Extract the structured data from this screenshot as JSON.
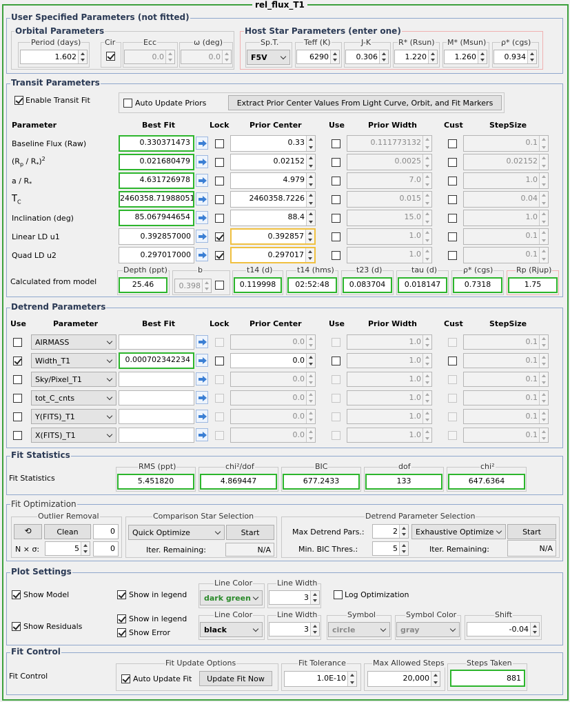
{
  "window_title": "rel_flux_T1",
  "user_params": {
    "title": "User Specified Parameters (not fitted)",
    "orbital": {
      "title": "Orbital Parameters",
      "period_label": "Period (days)",
      "period": "1.602",
      "cir_label": "Cir",
      "ecc_label": "Ecc",
      "ecc": "0.0",
      "omega_label": "ω (deg)",
      "omega": "0.0"
    },
    "host": {
      "title": "Host Star Parameters (enter one)",
      "spt_label": "Sp.T.",
      "spt": "F5V",
      "teff_label": "Teff (K)",
      "teff": "6290",
      "jk_label": "J-K",
      "jk": "0.306",
      "rstar_label": "R* (Rsun)",
      "rstar": "1.220",
      "mstar_label": "M* (Msun)",
      "mstar": "1.260",
      "rho_label": "ρ* (cgs)",
      "rho": "0.934"
    }
  },
  "transit": {
    "title": "Transit Parameters",
    "enable_label": "Enable Transit Fit",
    "auto_update_label": "Auto Update Priors",
    "extract_button": "Extract Prior Center Values From Light Curve, Orbit, and Fit Markers",
    "headers": {
      "parameter": "Parameter",
      "best_fit": "Best Fit",
      "lock": "Lock",
      "prior_center": "Prior Center",
      "use": "Use",
      "prior_width": "Prior Width",
      "cust": "Cust",
      "step": "StepSize"
    },
    "rows": [
      {
        "name": "Baseline Flux (Raw)",
        "best": "0.330371473",
        "center": "0.33",
        "width": "0.111773132",
        "step": "0.1"
      },
      {
        "name": "(Rp / R*)2",
        "best": "0.021680479",
        "center": "0.02152",
        "width": "0.0025",
        "step": "0.02152"
      },
      {
        "name": "a / R*",
        "best": "4.631726978",
        "center": "4.979",
        "width": "7.0",
        "step": "1.0"
      },
      {
        "name": "TC",
        "best": "2460358.719880510",
        "center": "2460358.7226",
        "width": "0.015",
        "step": "0.04"
      },
      {
        "name": "Inclination (deg)",
        "best": "85.067944654",
        "center": "88.4",
        "width": "15.0",
        "step": "1.0"
      },
      {
        "name": "Linear LD u1",
        "best": "0.392857000",
        "center": "0.392857",
        "width": "1.0",
        "step": "0.1"
      },
      {
        "name": "Quad LD u2",
        "best": "0.297017000",
        "center": "0.297017",
        "width": "1.0",
        "step": "0.1"
      }
    ],
    "calc_label": "Calculated from model",
    "calc": [
      {
        "label": "Depth (ppt)",
        "value": "25.46"
      },
      {
        "label": "b",
        "value": "0.398"
      },
      {
        "label": "t14 (d)",
        "value": "0.119998"
      },
      {
        "label": "t14 (hms)",
        "value": "02:52:48"
      },
      {
        "label": "t23 (d)",
        "value": "0.083704"
      },
      {
        "label": "tau (d)",
        "value": "0.018147"
      },
      {
        "label": "ρ* (cgs)",
        "value": "0.7318"
      },
      {
        "label": "Rp (Rjup)",
        "value": "1.75"
      }
    ]
  },
  "detrend": {
    "title": "Detrend Parameters",
    "headers": {
      "use": "Use",
      "parameter": "Parameter",
      "best_fit": "Best Fit",
      "lock": "Lock",
      "prior_center": "Prior Center",
      "use2": "Use",
      "prior_width": "Prior Width",
      "cust": "Cust",
      "step": "StepSize"
    },
    "rows": [
      {
        "name": "AIRMASS",
        "best": "",
        "center": "0.0",
        "width": "1.0",
        "step": "0.1"
      },
      {
        "name": "Width_T1",
        "best": "0.000702342234",
        "center": "0.0",
        "width": "1.0",
        "step": "0.1"
      },
      {
        "name": "Sky/Pixel_T1",
        "best": "",
        "center": "0.0",
        "width": "1.0",
        "step": "0.1"
      },
      {
        "name": "tot_C_cnts",
        "best": "",
        "center": "0.0",
        "width": "1.0",
        "step": "0.1"
      },
      {
        "name": "Y(FITS)_T1",
        "best": "",
        "center": "0.0",
        "width": "1.0",
        "step": "0.1"
      },
      {
        "name": "X(FITS)_T1",
        "best": "",
        "center": "0.0",
        "width": "1.0",
        "step": "0.1"
      }
    ]
  },
  "fit_stats": {
    "title": "Fit Statistics",
    "label": "Fit Statistics",
    "items": [
      {
        "label": "RMS (ppt)",
        "value": "5.451820"
      },
      {
        "label": "chi²/dof",
        "value": "4.869447"
      },
      {
        "label": "BIC",
        "value": "677.2433"
      },
      {
        "label": "dof",
        "value": "133"
      },
      {
        "label": "chi²",
        "value": "647.6364"
      }
    ]
  },
  "fit_opt": {
    "title": "Fit Optimization",
    "outlier": {
      "title": "Outlier Removal",
      "clean": "Clean",
      "count1": "0",
      "nsigma_label": "N × σ:",
      "nsigma": "5",
      "count2": "0"
    },
    "comp": {
      "title": "Comparison Star Selection",
      "mode": "Quick Optimize",
      "start": "Start",
      "iter_label": "Iter. Remaining:",
      "iter": "N/A"
    },
    "detrend_sel": {
      "title": "Detrend Parameter Selection",
      "max_label": "Max Detrend Pars.:",
      "max": "2",
      "mode": "Exhaustive Optimize",
      "start": "Start",
      "bic_label": "Min. BIC Thres.:",
      "bic": "5",
      "iter_label": "Iter. Remaining:",
      "iter": "N/A"
    }
  },
  "plot": {
    "title": "Plot Settings",
    "show_model": "Show Model",
    "show_legend1": "Show in legend",
    "line_color_label": "Line Color",
    "model_color": "dark green",
    "line_width_label": "Line Width",
    "model_width": "3",
    "log_opt": "Log Optimization",
    "show_residuals": "Show Residuals",
    "show_legend2": "Show in legend",
    "show_error": "Show Error",
    "resid_color": "black",
    "resid_width": "3",
    "symbol_label": "Symbol",
    "symbol": "circle",
    "symbol_color_label": "Symbol Color",
    "symbol_color": "gray",
    "shift_label": "Shift",
    "shift": "-0.04"
  },
  "fit_control": {
    "title": "Fit Control",
    "label": "Fit Control",
    "update_title": "Fit Update Options",
    "auto_update": "Auto Update Fit",
    "update_now": "Update Fit Now",
    "tol_label": "Fit Tolerance",
    "tol": "1.0E-10",
    "max_label": "Max Allowed Steps",
    "max": "20,000",
    "steps_label": "Steps Taken",
    "steps": "881"
  },
  "colors": {
    "green_border": "#2cb52c",
    "orange_border": "#f0c040",
    "panel_border": "#8fa7cc",
    "model_color": "#2a8a2a"
  }
}
